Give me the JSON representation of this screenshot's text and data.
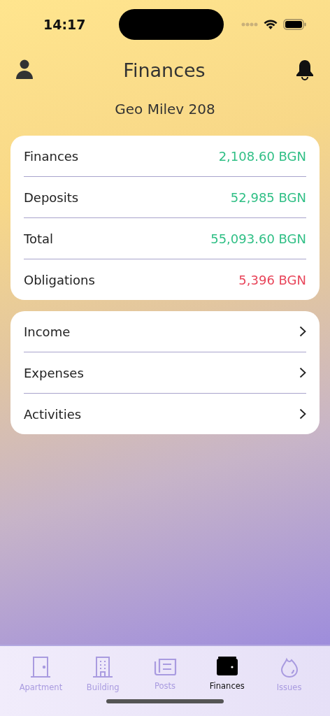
{
  "status_bar": {
    "time": "14:17"
  },
  "header": {
    "title": "Finances",
    "subtitle": "Geo Milev 208"
  },
  "balances": [
    {
      "label": "Finances",
      "value": "2,108.60 BGN",
      "kind": "positive"
    },
    {
      "label": "Deposits",
      "value": "52,985 BGN",
      "kind": "positive"
    },
    {
      "label": "Total",
      "value": "55,093.60 BGN",
      "kind": "positive"
    },
    {
      "label": "Obligations",
      "value": "5,396 BGN",
      "kind": "negative"
    }
  ],
  "links": [
    {
      "label": "Income"
    },
    {
      "label": "Expenses"
    },
    {
      "label": "Activities"
    }
  ],
  "tab_bar": [
    {
      "label": "Apartment",
      "selected": false
    },
    {
      "label": "Building",
      "selected": false
    },
    {
      "label": "Posts",
      "selected": false
    },
    {
      "label": "Finances",
      "selected": true
    },
    {
      "label": "Issues",
      "selected": false
    }
  ]
}
